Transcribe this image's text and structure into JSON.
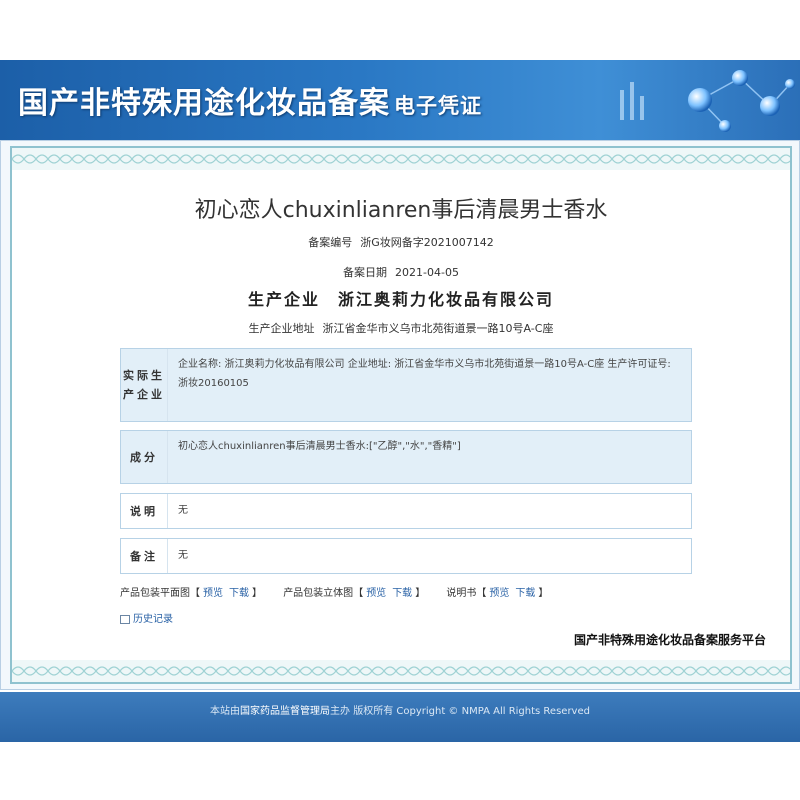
{
  "header": {
    "title": "国产非特殊用途化妆品备案",
    "subtitle": "电子凭证"
  },
  "certificate": {
    "product_name": "初心恋人chuxinlianren事后清晨男士香水",
    "record_number_label": "备案编号",
    "record_number": "浙G妆网备字2021007142",
    "record_date_label": "备案日期",
    "record_date": "2021-04-05",
    "manufacturer_label": "生产企业",
    "manufacturer": "浙江奥莉力化妆品有限公司",
    "address_label": "生产企业地址",
    "address": "浙江省金华市义乌市北苑街道景一路10号A-C座",
    "sections": [
      {
        "label": "实际生产企业",
        "text": "企业名称: 浙江奥莉力化妆品有限公司    企业地址: 浙江省金华市义乌市北苑街道景一路10号A-C座    生产许可证号: 浙妆20160105"
      },
      {
        "label": "成分",
        "text": "初心恋人chuxinlianren事后清晨男士香水:[\"乙醇\",\"水\",\"香精\"]"
      },
      {
        "label": "说明",
        "text": "无"
      },
      {
        "label": "备注",
        "text": "无"
      }
    ],
    "downloads": [
      {
        "label": "产品包装平面图",
        "preview": "预览",
        "download": "下载"
      },
      {
        "label": "产品包装立体图",
        "preview": "预览",
        "download": "下载"
      },
      {
        "label": "说明书",
        "preview": "预览",
        "download": "下载"
      }
    ],
    "history_link": "历史记录",
    "platform_name": "国产非特殊用途化妆品备案服务平台"
  },
  "footer": {
    "prefix": "本站由",
    "org": "国家药品监督管理局",
    "suffix": "主办 版权所有 Copyright © NMPA All Rights Reserved"
  },
  "colors": {
    "banner": "#2a78c4",
    "frame_border": "#8fc2cf",
    "section_bg": "#e2eff8",
    "link": "#2a62a6",
    "footer": "#2a65a6"
  }
}
